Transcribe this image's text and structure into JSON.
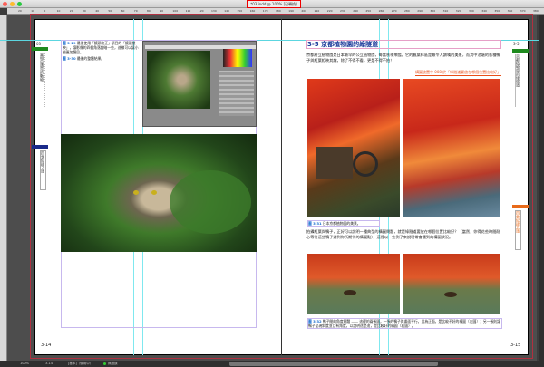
{
  "window": {
    "title": "*03.indd @ 100% [已轉換]"
  },
  "ruler": {
    "ticks": [
      "20",
      "10",
      "0",
      "10",
      "20",
      "30",
      "40",
      "50",
      "60",
      "70",
      "80",
      "90",
      "100",
      "110",
      "120",
      "130",
      "140",
      "150",
      "160",
      "170",
      "180",
      "190",
      "200",
      "210",
      "220",
      "230",
      "240",
      "250",
      "260",
      "270",
      "280",
      "290",
      "300",
      "310",
      "320",
      "330",
      "340",
      "350",
      "360",
      "370",
      "380"
    ]
  },
  "left_page": {
    "chapter": "03",
    "side_tab_1": "當相中遇見的動物",
    "side_tab_2": "四季紀錄之旅",
    "figure_captions": [
      {
        "label": "圖 3-29",
        "text": "最後使用「鏡頭校正」項目的「鏡頭暈映」，讓影像的四個角落變暗一些，這樣可以讓小貓更加醒目。"
      },
      {
        "label": "圖 3-30",
        "text": "最後的整體結果。"
      }
    ],
    "page_number": "3-14"
  },
  "right_page": {
    "heading": "3-5 京都植物園的綠隧道",
    "intro": "京都府立植物園是日本最早的公立植物園，每當秋季來臨，它的楓葉林區是最令人讚嘆的美景，而其中池塘的各種鴨子與紅葉相映其趣，除了不得不看，更是不得不拍！",
    "highlight": "構圖放置中 008 於「綠隧道要放在哪個位置比較好」",
    "caption_1": {
      "label": "圖 3-31",
      "text": "日本京都植物園的美景。"
    },
    "body": "拍攝紅葉與鴨子，正好可以說明一種典型的構圖問題，就是綠隧道要放在哪個位置比較好？（當然，你得花些時間耐心等待這些鴨子游到你所期待的構圖點），這裡以一些例子來說明常會遇到的構圖狀況。",
    "caption_2": {
      "label": "圖 3-32",
      "text": "鴨子間的角度問題 —— 這裡的兩張圖，一張的鴨子與畫面平行，且為正面，是比較不好的構圖（左圖）；另一張則讓鴨子呈現斜度並且有角度，以說明這是這，是比較好的構圖（右圖）。"
    },
    "side_tab_1": "京都植物園的綠隧道",
    "side_tab_2": "四季紀錄之旅",
    "chapter": "3-5",
    "page_number": "3-15"
  },
  "statusbar": {
    "zoom": "100%",
    "page": "3-14",
    "mode": "[基本]（使用中）",
    "status": "無錯誤"
  },
  "colors": {
    "green_tab": "#1e8a1e",
    "blue_tab": "#1a2a8a",
    "orange_tab": "#e86a1a",
    "heading": "#1a3a9a",
    "highlight": "#e8501a",
    "bleed": "#b03040",
    "guide": "#7fe8ef"
  }
}
